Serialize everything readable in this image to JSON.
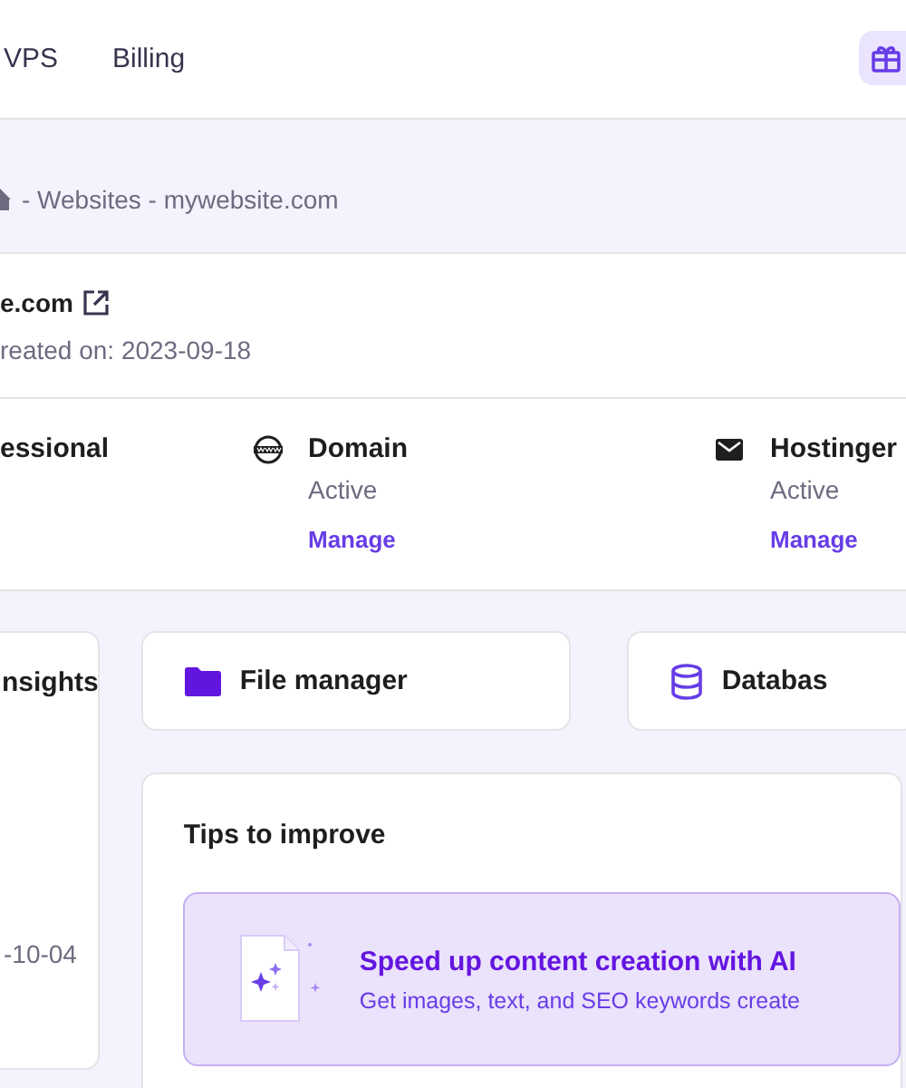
{
  "nav": {
    "items": [
      {
        "label": "VPS"
      },
      {
        "label": "Billing"
      }
    ]
  },
  "breadcrumb": {
    "text": "- Websites - mywebsite.com"
  },
  "site": {
    "name": "e.com",
    "created": "reated on: 2023-09-18"
  },
  "services": [
    {
      "kind": "plan",
      "title": "essional"
    },
    {
      "kind": "domain",
      "title": "Domain",
      "status": "Active",
      "action": "Manage"
    },
    {
      "kind": "email",
      "title": "Hostinger",
      "status": "Active",
      "action": "Manage"
    }
  ],
  "insights": {
    "title": "nsights",
    "date": "-10-04"
  },
  "shortcuts": [
    {
      "kind": "files",
      "label": "File manager"
    },
    {
      "kind": "database",
      "label": "Databas"
    }
  ],
  "tips": {
    "title": "Tips to improve",
    "items": [
      {
        "title": "Speed up content creation with AI",
        "text": "Get images, text, and SEO keywords create"
      }
    ]
  }
}
